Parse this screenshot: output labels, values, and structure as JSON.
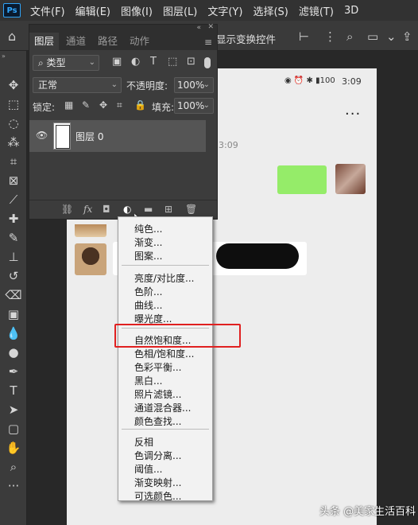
{
  "menubar": {
    "logo": "Ps",
    "items": [
      "文件(F)",
      "编辑(E)",
      "图像(I)",
      "图层(L)",
      "文字(Y)",
      "选择(S)",
      "滤镜(T)",
      "3D"
    ]
  },
  "options_bar": {
    "transform_label": "显示变换控件"
  },
  "layers_panel": {
    "tabs": [
      "图层",
      "通道",
      "路径",
      "动作"
    ],
    "filter_value": "类型",
    "blend_mode": "正常",
    "opacity_label": "不透明度:",
    "opacity_value": "100%",
    "lock_label": "锁定:",
    "fill_label": "填充:",
    "fill_value": "100%",
    "layer_name": "图层 0"
  },
  "document": {
    "status_time": "3:09",
    "status_battery": "100",
    "chat_time": "3:09",
    "more": "..."
  },
  "adjustment_menu": {
    "group1": [
      "纯色...",
      "渐变...",
      "图案..."
    ],
    "group2": [
      "亮度/对比度...",
      "色阶...",
      "曲线...",
      "曝光度..."
    ],
    "group3": [
      "自然饱和度...",
      "色相/饱和度...",
      "色彩平衡...",
      "黑白...",
      "照片滤镜...",
      "通道混合器...",
      "颜色查找..."
    ],
    "group4": [
      "反相",
      "色调分离...",
      "阈值...",
      "渐变映射...",
      "可选颜色..."
    ],
    "highlighted": "自然饱和度..."
  },
  "watermark": "头条 @美家生活百科",
  "colors": {
    "highlight_box": "#e02020",
    "sticker_bubble": "#95ec69",
    "ps_accent": "#31a8ff"
  },
  "icons": {
    "toolbar": [
      "move-icon",
      "marquee-icon",
      "lasso-icon",
      "magic-wand-icon",
      "crop-icon",
      "frame-icon",
      "eyedropper-icon",
      "healing-icon",
      "brush-icon",
      "stamp-icon",
      "history-brush-icon",
      "eraser-icon",
      "gradient-icon",
      "blur-icon",
      "dodge-icon",
      "pen-icon",
      "type-icon",
      "path-select-icon",
      "rectangle-icon",
      "hand-icon",
      "zoom-icon",
      "more-tools-icon"
    ]
  }
}
